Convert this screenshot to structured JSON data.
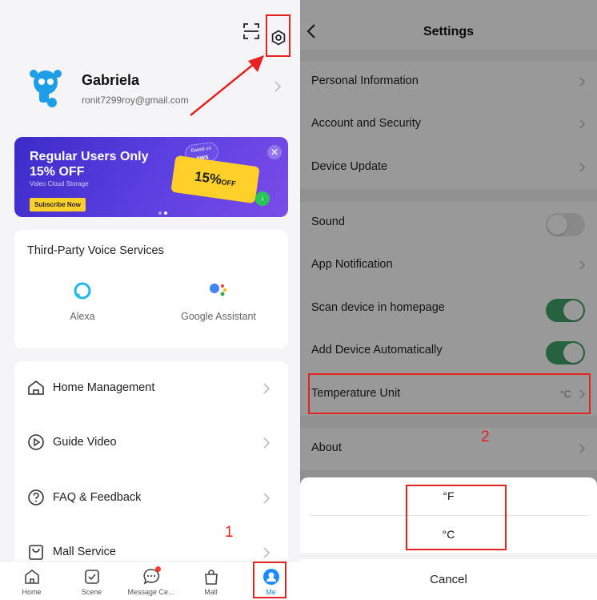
{
  "left": {
    "profile": {
      "name": "Gabriela",
      "email": "ronit7299roy@gmail.com"
    },
    "banner": {
      "title": "Regular Users Only 15% OFF",
      "subtitle": "Video Cloud Storage",
      "button": "Subscribe Now",
      "coupon_value": "15%",
      "coupon_suffix": "OFF",
      "badge_line1": "Based on",
      "badge_line2": "aws",
      "close": "✕"
    },
    "voice_services": {
      "title": "Third-Party Voice Services",
      "items": [
        {
          "label": "Alexa",
          "icon": "alexa-icon"
        },
        {
          "label": "Google Assistant",
          "icon": "google-assistant-icon"
        }
      ]
    },
    "menu": [
      {
        "label": "Home Management",
        "icon": "home-icon"
      },
      {
        "label": "Guide Video",
        "icon": "play-icon"
      },
      {
        "label": "FAQ & Feedback",
        "icon": "help-icon"
      },
      {
        "label": "Mall Service",
        "icon": "bag-icon"
      }
    ],
    "tabbar": [
      {
        "label": "Home",
        "icon": "home-icon"
      },
      {
        "label": "Scene",
        "icon": "scene-icon"
      },
      {
        "label": "Message Ce...",
        "icon": "message-icon"
      },
      {
        "label": "Mall",
        "icon": "mall-icon"
      },
      {
        "label": "Me",
        "icon": "me-icon",
        "active": true
      }
    ],
    "annotation_number": "1"
  },
  "right": {
    "title": "Settings",
    "group1": [
      "Personal Information",
      "Account and Security",
      "Device Update"
    ],
    "group2": [
      {
        "label": "Sound",
        "type": "toggle",
        "on": false
      },
      {
        "label": "App Notification",
        "type": "chevron"
      },
      {
        "label": "Scan device in homepage",
        "type": "toggle",
        "on": true
      },
      {
        "label": "Add Device Automatically",
        "type": "toggle",
        "on": true
      },
      {
        "label": "Temperature Unit",
        "type": "value",
        "value": "°C"
      }
    ],
    "group3": [
      "About"
    ],
    "sheet": {
      "option_f": "°F",
      "option_c": "°C",
      "cancel": "Cancel"
    },
    "annotation_number": "2"
  },
  "colors": {
    "annotation": "#e52421",
    "accent": "#1a8cff",
    "toggle_on": "#3fa66a",
    "banner": "#4a35d6"
  }
}
